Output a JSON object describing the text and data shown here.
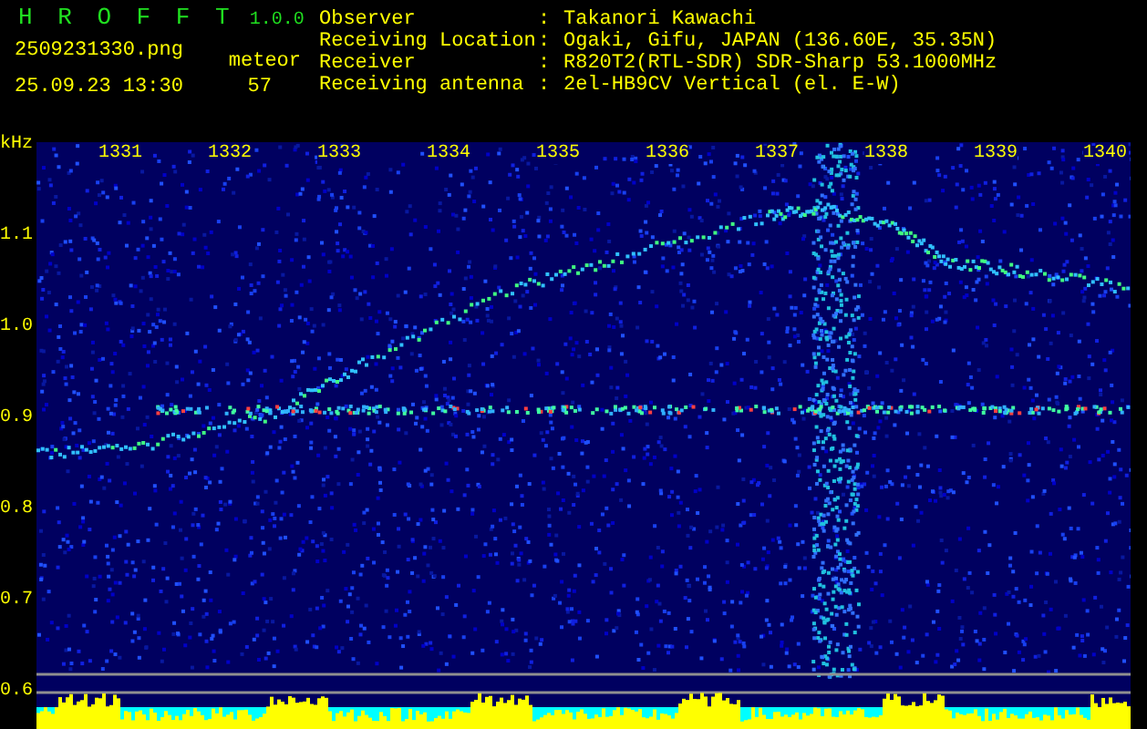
{
  "header": {
    "app_title": "H R O F F T",
    "version": "1.0.0",
    "filename": "2509231330.png",
    "datetime": "25.09.23 13:30",
    "meteor_label": "meteor",
    "meteor_count": "57"
  },
  "info": [
    {
      "label": "Observer",
      "separator": ":",
      "value": "Takanori Kawachi"
    },
    {
      "label": "Receiving Location",
      "separator": ":",
      "value": "Ogaki, Gifu, JAPAN (136.60E, 35.35N)"
    },
    {
      "label": "Receiver",
      "separator": ":",
      "value": "R820T2(RTL-SDR) SDR-Sharp 53.1000MHz"
    },
    {
      "label": "Receiving antenna",
      "separator": ":",
      "value": "2el-HB9CV Vertical (el. E-W)"
    }
  ],
  "plot": {
    "unit": "kHz",
    "x_labels": [
      "1331",
      "1332",
      "1333",
      "1334",
      "1335",
      "1336",
      "1337",
      "1338",
      "1339",
      "1340"
    ],
    "y_labels": [
      "1.1",
      "1.0",
      "0.9",
      "0.8",
      "0.7",
      "0.6"
    ]
  }
}
